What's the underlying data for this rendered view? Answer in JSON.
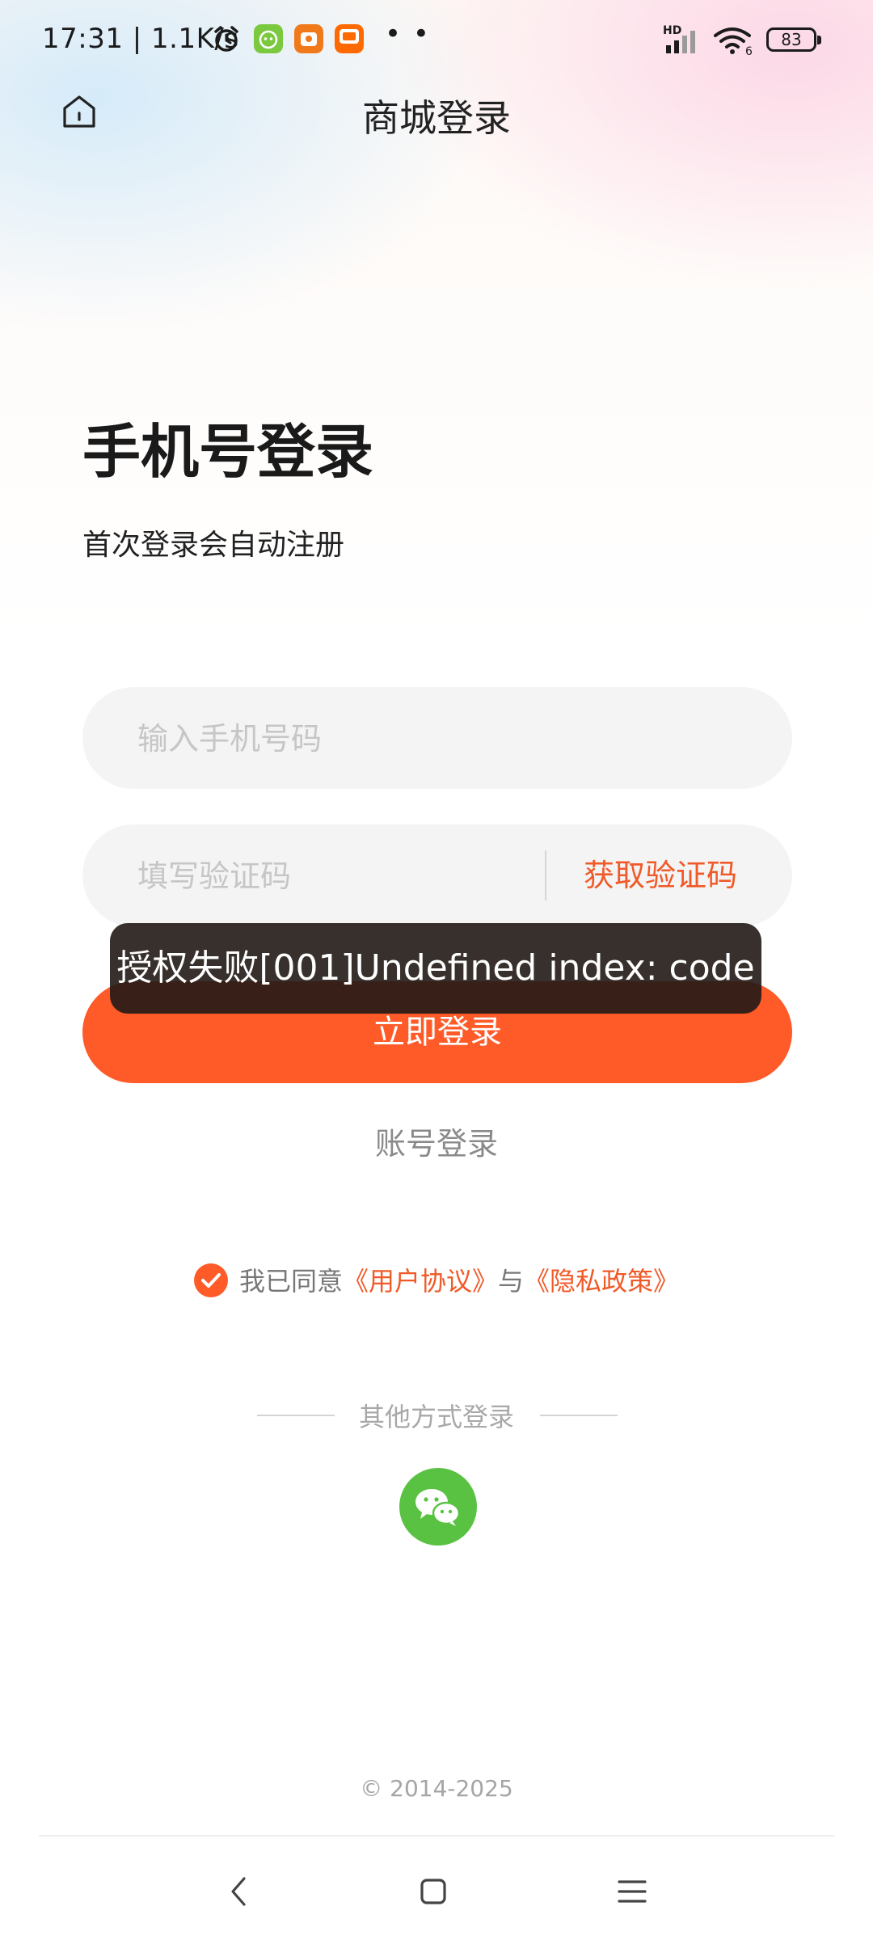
{
  "status_bar": {
    "time": "17:31 | 1.1K/s",
    "icons": [
      "alarm-clock-icon",
      "green-app-icon",
      "orange-app-icon",
      "taobao-app-icon"
    ],
    "more_dots": "• •",
    "signal": "HD",
    "wifi_badge": "6",
    "battery": "83"
  },
  "header": {
    "title": "商城登录",
    "home_icon": "home-icon"
  },
  "login": {
    "heading": "手机号登录",
    "subheading": "首次登录会自动注册",
    "phone_placeholder": "输入手机号码",
    "code_placeholder": "填写验证码",
    "get_code_label": "获取验证码",
    "submit_label": "立即登录",
    "account_login_label": "账号登录"
  },
  "toast": {
    "message": "授权失败[001]Undefined index: code"
  },
  "agreement": {
    "checked": true,
    "prefix": "我已同意",
    "user_agreement": "《用户协议》",
    "joiner": "与",
    "privacy_policy": "《隐私政策》"
  },
  "other_login": {
    "label": "其他方式登录",
    "wechat_icon": "wechat-icon"
  },
  "footer": {
    "copyright": "© 2014-2025"
  },
  "nav_bar": {
    "icons": [
      "back-icon",
      "home-square-icon",
      "menu-icon"
    ]
  },
  "colors": {
    "accent": "#ff5b29",
    "link": "#f05a28",
    "wechat": "#5ac242",
    "toast_bg": "#221916"
  }
}
